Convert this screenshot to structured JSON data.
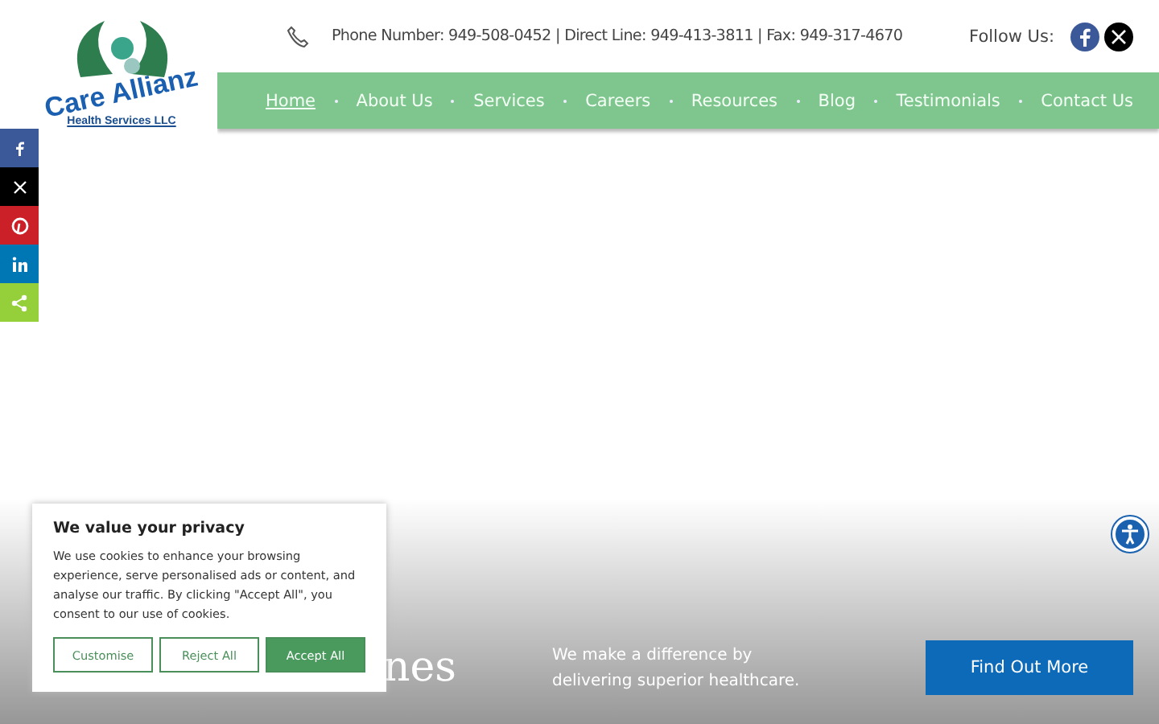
{
  "logo": {
    "name": "Care Allianz",
    "subtitle": "Health Services LLC"
  },
  "contact": {
    "text": "Phone Number: 949-508-0452 | Direct Line: 949-413-3811 | Fax: 949-317-4670"
  },
  "follow": {
    "label": "Follow Us:",
    "icons": [
      {
        "kind": "facebook"
      },
      {
        "kind": "x"
      }
    ]
  },
  "nav": [
    {
      "label": "Home",
      "selected": true
    },
    {
      "label": "About Us",
      "selected": false
    },
    {
      "label": "Services",
      "selected": false
    },
    {
      "label": "Careers",
      "selected": false
    },
    {
      "label": "Resources",
      "selected": false
    },
    {
      "label": "Blog",
      "selected": false
    },
    {
      "label": "Testimonials",
      "selected": false
    },
    {
      "label": "Contact Us",
      "selected": false
    }
  ],
  "share": [
    {
      "kind": "facebook",
      "color": "#3b5998"
    },
    {
      "kind": "x",
      "color": "#000000"
    },
    {
      "kind": "pinterest",
      "color": "#cb2027"
    },
    {
      "kind": "linkedin",
      "color": "#0077b5"
    },
    {
      "kind": "share",
      "color": "#95d03a"
    }
  ],
  "hero": {
    "heading_visible": "nes",
    "text": "We make a difference by delivering superior healthcare.",
    "button": "Find Out More"
  },
  "cookie": {
    "title": "We value your privacy",
    "text": "We use cookies to enhance your browsing experience, serve personalised ads or content, and analyse our traffic. By clicking \"Accept All\", you consent to our use of cookies.",
    "buttons": [
      {
        "label": "Customise",
        "kind": "outline"
      },
      {
        "label": "Reject All",
        "kind": "outline"
      },
      {
        "label": "Accept All",
        "kind": "primary"
      }
    ]
  }
}
